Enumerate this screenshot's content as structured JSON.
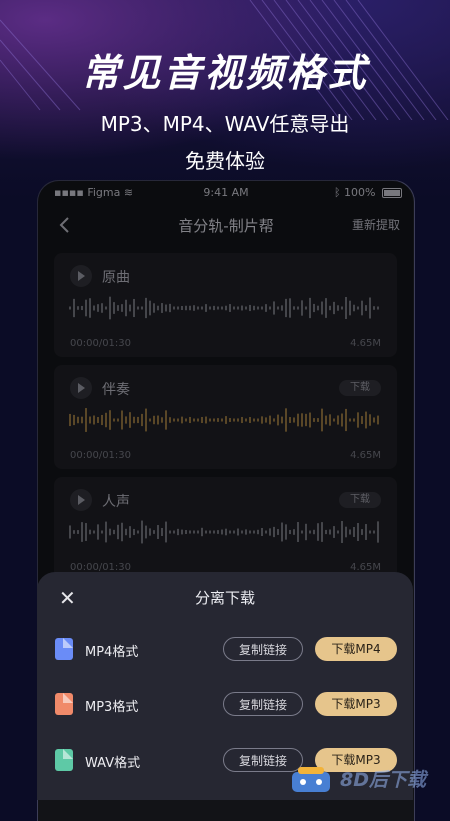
{
  "promo": {
    "title": "常见音视频格式",
    "subtitle1": "MP3、MP4、WAV任意导出",
    "subtitle2": "免费体验"
  },
  "status_bar": {
    "carrier": "Figma",
    "time": "9:41 AM",
    "battery": "100%"
  },
  "nav": {
    "title": "音分轨-制片帮",
    "refetch": "重新提取"
  },
  "tracks": [
    {
      "name": "原曲",
      "time": "00:00/01:30",
      "size": "4.65M",
      "download": "",
      "wave_color": "#6b6c74"
    },
    {
      "name": "伴奏",
      "time": "00:00/01:30",
      "size": "4.65M",
      "download": "下载",
      "wave_color": "#8a6e3c"
    },
    {
      "name": "人声",
      "time": "00:00/01:30",
      "size": "4.65M",
      "download": "下载",
      "wave_color": "#6b6c74"
    }
  ],
  "sheet": {
    "title": "分离下载",
    "rows": [
      {
        "label": "MP4格式",
        "copy": "复制链接",
        "download": "下载MP4",
        "icon": "video-file-icon",
        "color": "#6a8cf7"
      },
      {
        "label": "MP3格式",
        "copy": "复制链接",
        "download": "下载MP3",
        "icon": "audio-file-icon",
        "color": "#f08a6a"
      },
      {
        "label": "WAV格式",
        "copy": "复制链接",
        "download": "下载MP3",
        "icon": "wav-file-icon",
        "color": "#5ec9a6"
      }
    ]
  },
  "watermark": {
    "text": "8D后下载"
  },
  "colors": {
    "accent": "#e6c58c",
    "background": "#0b0c26"
  }
}
